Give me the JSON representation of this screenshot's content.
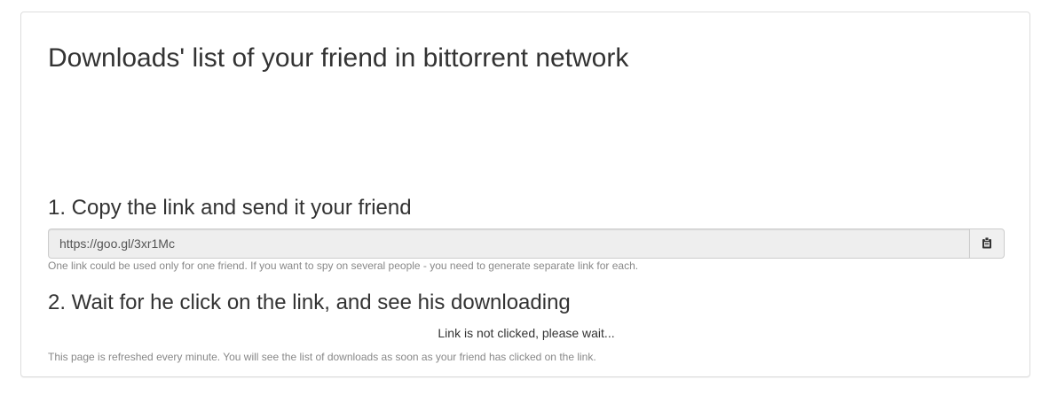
{
  "page": {
    "title": "Downloads' list of your friend in bittorrent network"
  },
  "step1": {
    "heading": "1. Copy the link and send it your friend",
    "link_value": "https://goo.gl/3xr1Mc",
    "copy_icon": "clipboard-icon",
    "help": "One link could be used only for one friend. If you want to spy on several people - you need to generate separate link for each."
  },
  "step2": {
    "heading": "2. Wait for he click on the link, and see his downloading",
    "status": "Link is not clicked, please wait...",
    "help": "This page is refreshed every minute. You will see the list of downloads as soon as your friend has clicked on the link."
  }
}
